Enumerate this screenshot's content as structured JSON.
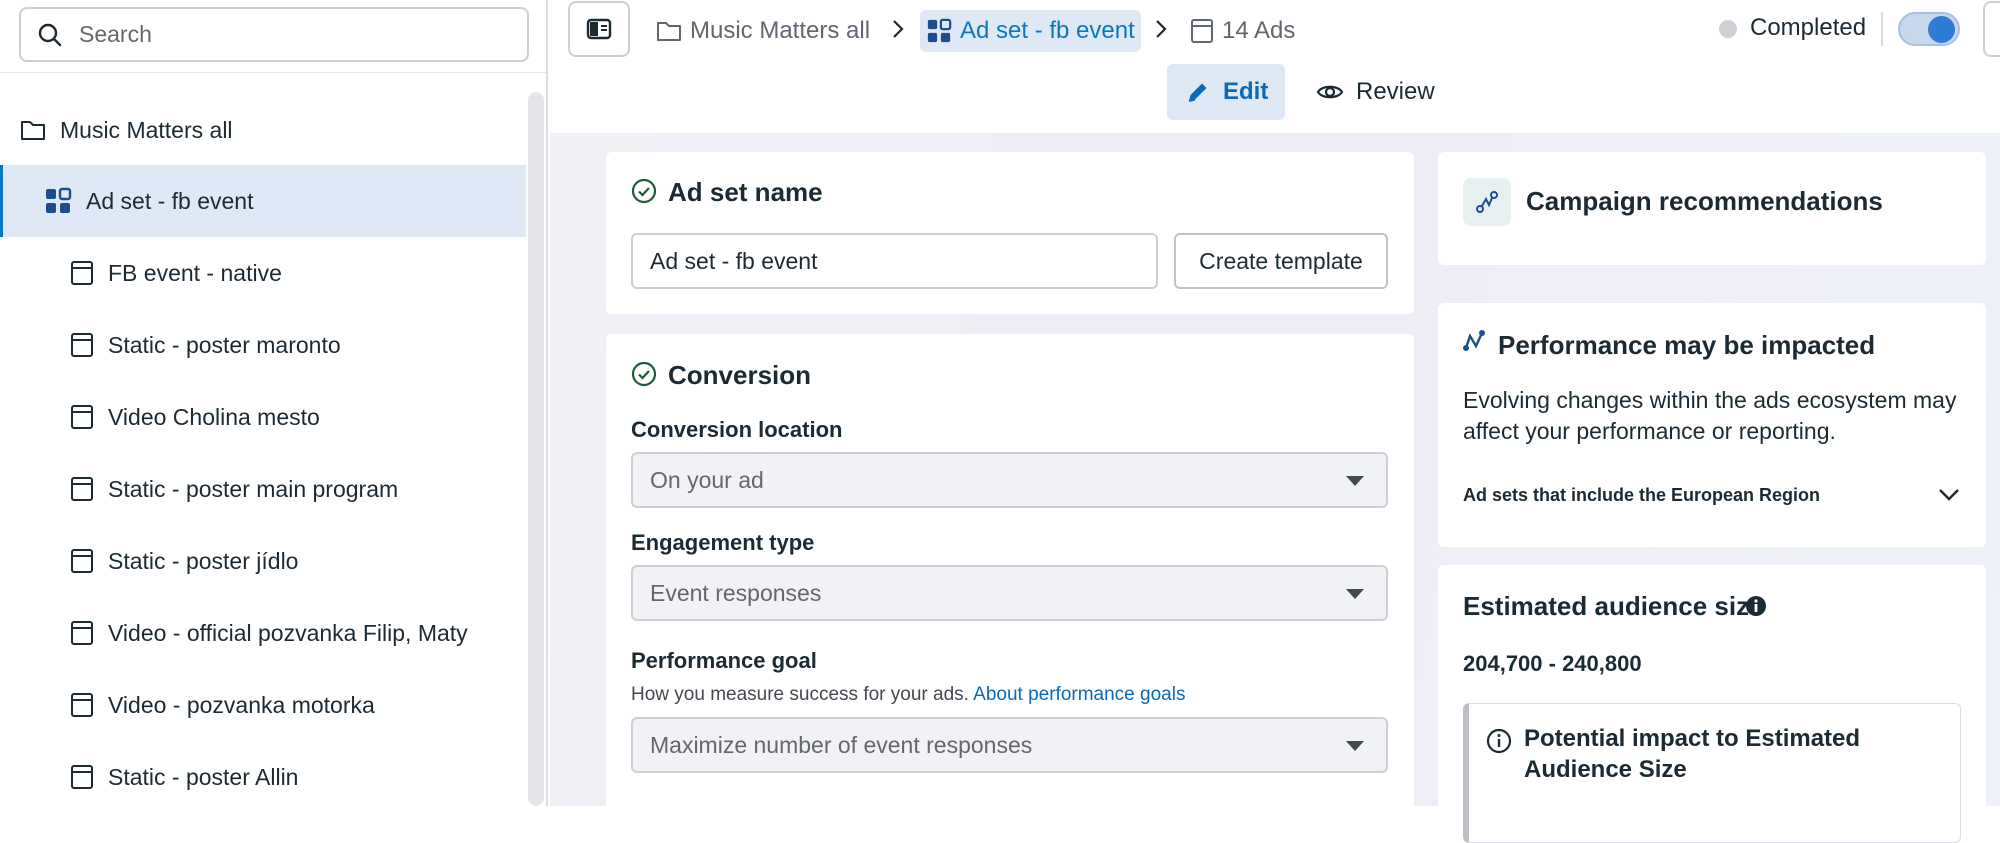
{
  "sidebar": {
    "search_placeholder": "Search",
    "items": [
      {
        "label": "Music Matters all",
        "icon": "folder-icon"
      },
      {
        "label": "Ad set - fb event",
        "icon": "adset-grid-icon"
      },
      {
        "label": "FB event - native",
        "icon": "ad-icon"
      },
      {
        "label": "Static - poster maronto",
        "icon": "ad-icon"
      },
      {
        "label": "Video Cholina mesto",
        "icon": "ad-icon"
      },
      {
        "label": "Static - poster main program",
        "icon": "ad-icon"
      },
      {
        "label": "Static - poster jídlo",
        "icon": "ad-icon"
      },
      {
        "label": "Video - official pozvanka Filip, Maty",
        "icon": "ad-icon"
      },
      {
        "label": "Video - pozvanka motorka",
        "icon": "ad-icon"
      },
      {
        "label": "Static - poster Allin",
        "icon": "ad-icon"
      }
    ]
  },
  "breadcrumb": {
    "campaign": "Music Matters all",
    "adset": "Ad set - fb event",
    "ads": "14 Ads"
  },
  "status": {
    "label": "Completed"
  },
  "modes": {
    "edit": "Edit",
    "review": "Review"
  },
  "adset_name_card": {
    "title": "Ad set name",
    "value": "Ad set - fb event",
    "create_template": "Create template"
  },
  "conversion_card": {
    "title": "Conversion",
    "location_label": "Conversion location",
    "location_value": "On your ad",
    "engagement_label": "Engagement type",
    "engagement_value": "Event responses",
    "goal_label": "Performance goal",
    "goal_help": "How you measure success for your ads.",
    "goal_link": "About performance goals",
    "goal_value": "Maximize number of event responses"
  },
  "recommendations_card": {
    "title": "Campaign recommendations"
  },
  "performance_card": {
    "title": "Performance may be impacted",
    "body": "Evolving changes within the ads ecosystem may affect your performance or reporting.",
    "expander": "Ad sets that include the European Region"
  },
  "audience_card": {
    "title": "Estimated audience size",
    "range": "204,700 - 240,800",
    "impact_title": "Potential impact to Estimated Audience Size"
  },
  "colors": {
    "accent": "#0a78be",
    "selected_bg": "#dfe9f6",
    "status_dot": "#ccd0d5"
  }
}
